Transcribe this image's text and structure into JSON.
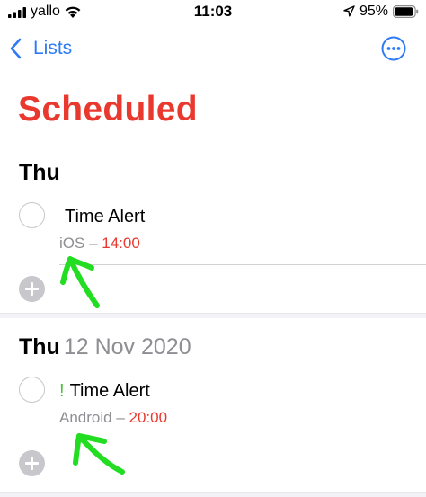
{
  "status_bar": {
    "carrier": "yallo",
    "time": "11:03",
    "battery_percent": "95%",
    "battery_level": 0.95,
    "icons": [
      "signal-icon",
      "wifi-icon",
      "location-arrow-icon",
      "battery-icon"
    ]
  },
  "nav": {
    "back_label": "Lists",
    "more_icon": "ellipsis-circle-icon"
  },
  "page_title": "Scheduled",
  "sections": [
    {
      "day": "Thu",
      "date": "",
      "task": {
        "priority": "",
        "title": "Time Alert",
        "label": "iOS",
        "separator": " – ",
        "time": "14:00",
        "completed": false
      }
    },
    {
      "day": "Thu",
      "date": "12 Nov 2020",
      "task": {
        "priority": "!",
        "title": "Time Alert",
        "label": "Android",
        "separator": " – ",
        "time": "20:00",
        "completed": false
      }
    }
  ],
  "colors": {
    "accent_blue": "#2f7bf5",
    "title_red": "#e9392e",
    "priority_green": "#4cbf3a",
    "annotation_green": "#22dd22",
    "secondary_gray": "#8e8e93"
  }
}
